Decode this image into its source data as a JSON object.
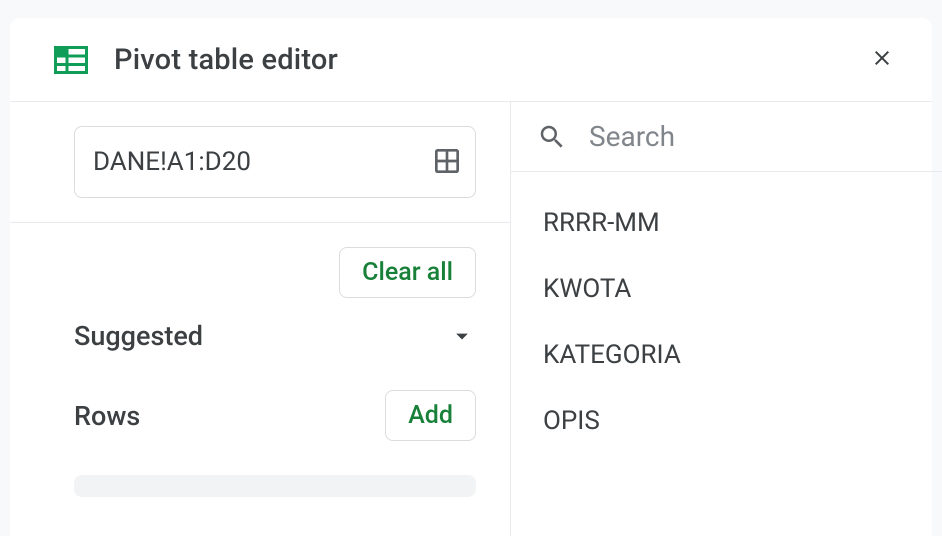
{
  "header": {
    "title": "Pivot table editor"
  },
  "range": {
    "value": "DANE!A1:D20"
  },
  "actions": {
    "clear_all": "Clear all",
    "add": "Add"
  },
  "sections": {
    "suggested": "Suggested",
    "rows": "Rows"
  },
  "search": {
    "placeholder": "Search"
  },
  "fields": [
    "RRRR-MM",
    "KWOTA",
    "KATEGORIA",
    "OPIS"
  ],
  "colors": {
    "accent_green": "#188038",
    "icon_green": "#0f9d58"
  }
}
